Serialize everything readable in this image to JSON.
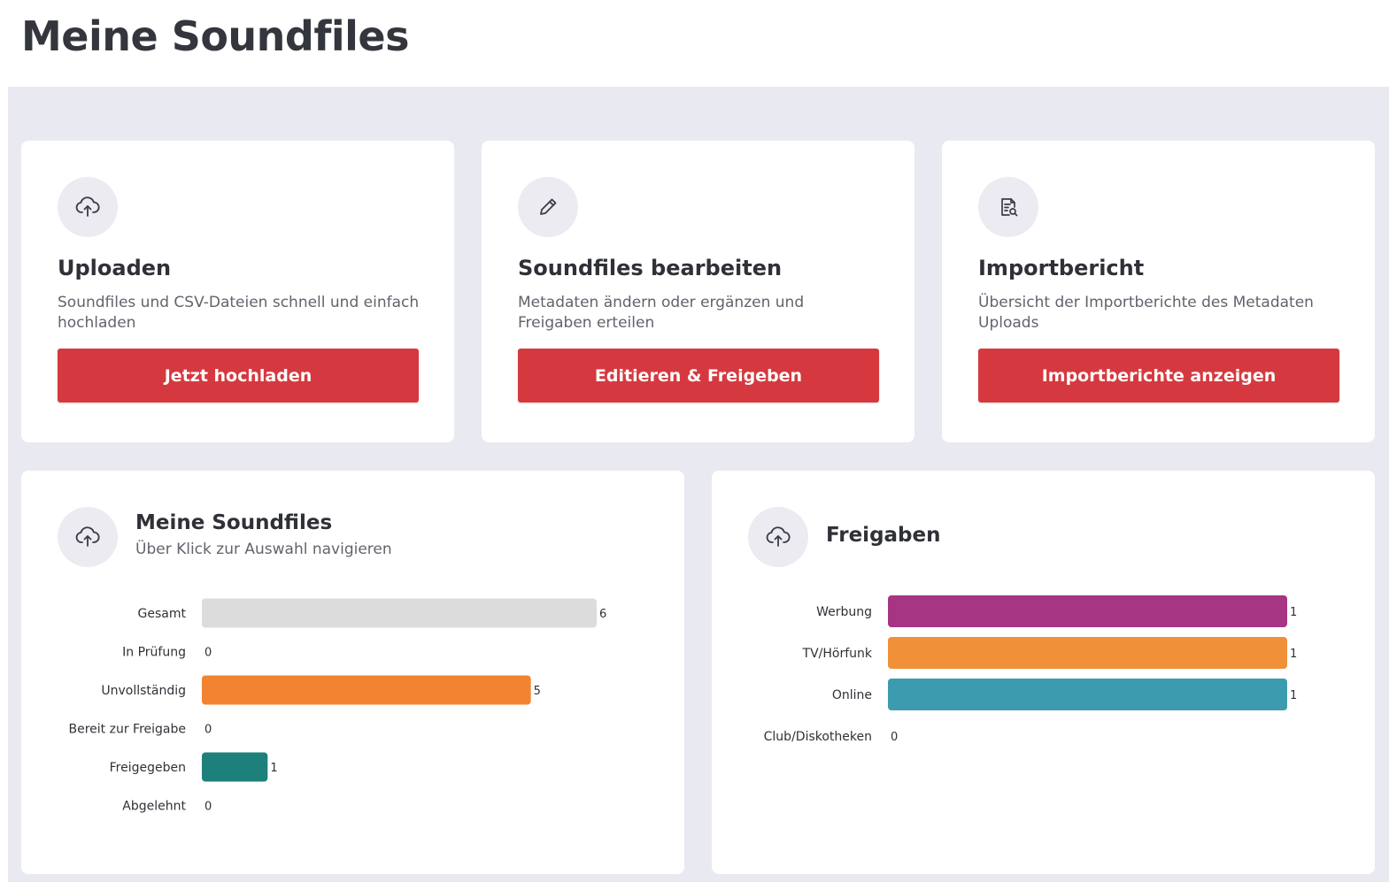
{
  "page": {
    "title": "Meine Soundfiles"
  },
  "cards": [
    {
      "icon": "cloud-upload-icon",
      "title": "Uploaden",
      "description": "Soundfiles und CSV-Dateien schnell und einfach hochladen",
      "button_label": "Jetzt hochladen"
    },
    {
      "icon": "pencil-icon",
      "title": "Soundfiles bearbeiten",
      "description": "Metadaten ändern oder ergänzen und Freigaben erteilen",
      "button_label": "Editieren & Freigeben"
    },
    {
      "icon": "report-search-icon",
      "title": "Importbericht",
      "description": "Übersicht der Importberichte des Metadaten Uploads",
      "button_label": "Importberichte anzeigen"
    }
  ],
  "colors": {
    "accent": "#d5393f",
    "background": "#e9e9f1"
  },
  "soundfiles_panel": {
    "icon": "cloud-upload-icon",
    "title": "Meine Soundfiles",
    "subtitle": "Über Klick zur Auswahl navigieren"
  },
  "freigaben_panel": {
    "icon": "cloud-upload-icon",
    "title": "Freigaben"
  },
  "chart_data": [
    {
      "type": "bar",
      "orientation": "horizontal",
      "categories": [
        "Gesamt",
        "In Prüfung",
        "Unvollständig",
        "Bereit zur Freigabe",
        "Freigegeben",
        "Abgelehnt"
      ],
      "values": [
        6,
        0,
        5,
        0,
        1,
        0
      ],
      "colors": [
        "#dcdcdc",
        "#dcdcdc",
        "#f28431",
        "#dcdcdc",
        "#1e807a",
        "#dcdcdc"
      ],
      "xlim": [
        0,
        6
      ]
    },
    {
      "type": "bar",
      "orientation": "horizontal",
      "categories": [
        "Werbung",
        "TV/Hörfunk",
        "Online",
        "Club/Diskotheken"
      ],
      "values": [
        1,
        1,
        1,
        0
      ],
      "colors": [
        "#a63583",
        "#f09038",
        "#3d9bb0",
        "#dcdcdc"
      ],
      "xlim": [
        0,
        1
      ]
    }
  ]
}
